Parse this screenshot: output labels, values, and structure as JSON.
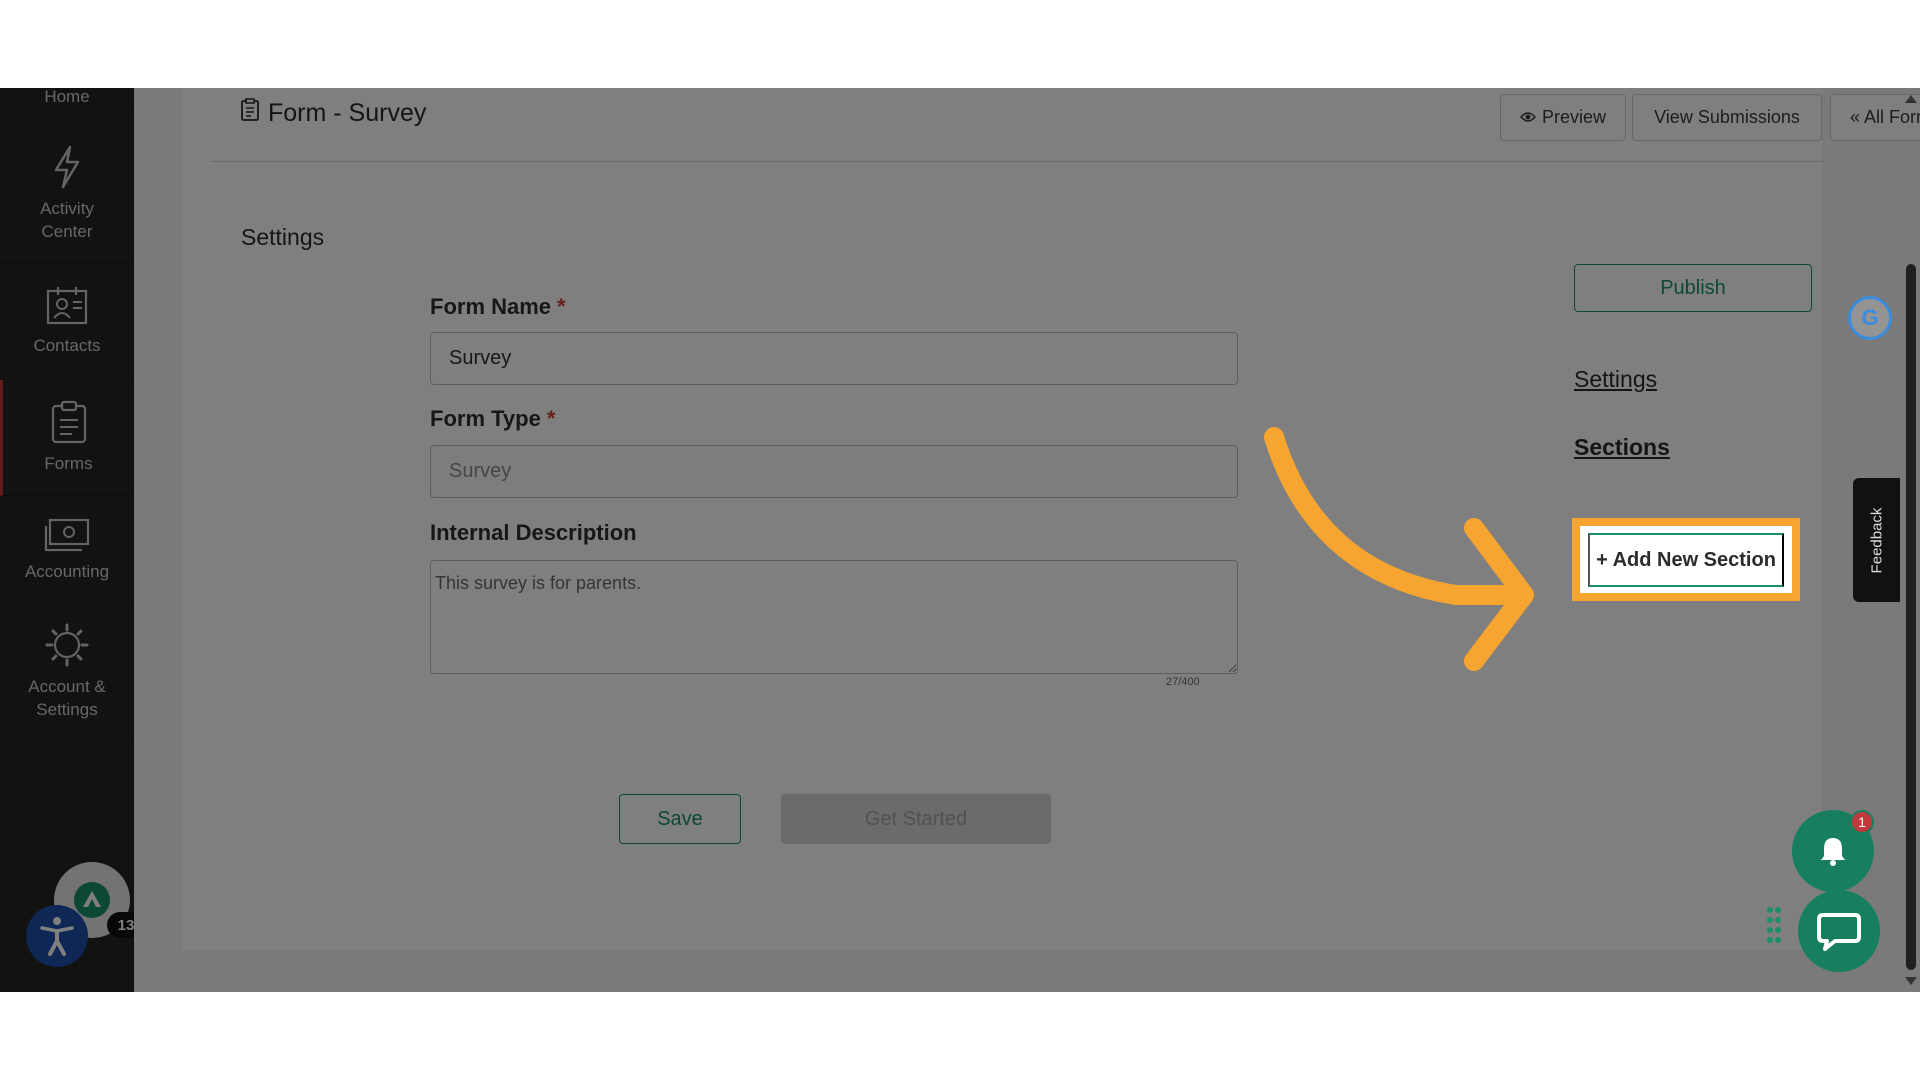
{
  "sidebar": {
    "items": [
      {
        "label": "Home",
        "icon": "home-icon"
      },
      {
        "label": "Activity Center",
        "icon": "lightning-icon"
      },
      {
        "label": "Contacts",
        "icon": "contacts-icon"
      },
      {
        "label": "Forms",
        "icon": "clipboard-icon"
      },
      {
        "label": "Accounting",
        "icon": "money-icon"
      },
      {
        "label": "Account & Settings",
        "icon": "gear-icon"
      }
    ],
    "active": "Forms",
    "avatar_badge": "13"
  },
  "header": {
    "title": "Form - Survey",
    "preview_label": "Preview",
    "view_submissions_label": "View Submissions",
    "all_forms_label": "« All Forms"
  },
  "settings": {
    "heading": "Settings",
    "form_name_label": "Form Name",
    "form_name_value": "Survey",
    "form_type_label": "Form Type",
    "form_type_value": "Survey",
    "required_mark": "*",
    "internal_description_label": "Internal Description",
    "internal_description_value": "This survey is for parents.",
    "char_count": "27/400",
    "save_label": "Save",
    "get_started_label": "Get Started"
  },
  "right_panel": {
    "publish_label": "Publish",
    "settings_link": "Settings",
    "sections_link": "Sections",
    "add_section_label": "+ Add New Section"
  },
  "widgets": {
    "feedback_label": "Feedback",
    "notification_count": "1"
  },
  "colors": {
    "brand": "#1b8f6c",
    "highlight": "#f7a531",
    "sidebar_bg": "#242424",
    "required": "#d23a3a"
  }
}
